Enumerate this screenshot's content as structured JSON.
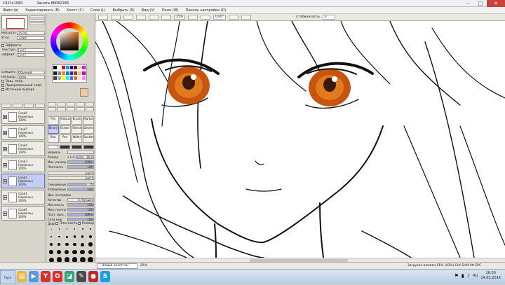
{
  "window": {
    "title": "1922x1080",
    "subtitle": "Занята 88082188",
    "controls": {
      "minimize": "–",
      "maximize": "□",
      "close": "✕"
    }
  },
  "menu": [
    "Файл (в)",
    "Редактировать (Е)",
    "Холст (С)",
    "Слой (L)",
    "Выбрать (S)",
    "Вид (V)",
    "Окно (W)",
    "Панель настройки (О)"
  ],
  "toolbar": {
    "angle": "0,00°",
    "zoom": "25%",
    "stabilizer_label": "Стабилизатор",
    "stabilizer_value": "3"
  },
  "navigator": {
    "zoom_label": "Масштаб",
    "zoom_value": "25.0%",
    "angle_label": "Угол",
    "angle_value": "+000°"
  },
  "layer_props": {
    "section": "Эффекты",
    "texture_label": "Текстура",
    "texture_value": "[нет]",
    "effect_label": "Эффект",
    "effect_value": "[нет]",
    "mode_label": "Смешение",
    "mode_value": "Обычный",
    "opacity_label": "Непрозрачн.",
    "opacity_value": "100%",
    "checks": [
      "Защ. непр.",
      "Прикрепленный слой",
      "Источник выбора"
    ]
  },
  "layers": [
    {
      "name": "Слой6",
      "mode": "Нормальн.",
      "opacity": "100%",
      "selected": false
    },
    {
      "name": "Слой5",
      "mode": "Нормальн.",
      "opacity": "100%",
      "selected": false
    },
    {
      "name": "Слой4",
      "mode": "Нормальн.",
      "opacity": "100%",
      "selected": false
    },
    {
      "name": "Слой3",
      "mode": "Нормальн.",
      "opacity": "100%",
      "selected": false
    },
    {
      "name": "Слой2",
      "mode": "Нормальн.",
      "opacity": "100%",
      "selected": true
    },
    {
      "name": "Слой1",
      "mode": "Нормальн.",
      "opacity": "100%",
      "selected": false
    },
    {
      "name": "Слой0",
      "mode": "Нормальн.",
      "opacity": "100%",
      "selected": false
    }
  ],
  "colors": {
    "current": "#f3c79a",
    "accent": "#c7cdf2",
    "swatches": [
      "#000000",
      "#ffffff",
      "#ff0000",
      "#00a0ff",
      "#0000ff",
      "#800000",
      "#ffcc99",
      "#ff00ff",
      "#222222",
      "#888888",
      "#ff8000",
      "#0080ff",
      "#3030a0",
      "#a04000",
      "#f0c080",
      "#c000c0",
      "#444444",
      "#aaaaaa",
      "#ffff00",
      "#00ffff",
      "#6060ff",
      "#c08040",
      "#ffe0c0",
      "#ff80ff"
    ]
  },
  "brushes": [
    "Pen",
    "Airbrush",
    "Brush",
    "Marker",
    "Binary",
    "Eraser",
    "Select",
    "Deselect",
    "Blur",
    "Pen",
    "Water",
    "Bucket"
  ],
  "brush_props": {
    "mode_label": "Нормаль",
    "size_label": "Размер",
    "size_mult": "x 1.0",
    "size_value": "10.0",
    "min_size_label": "Мин. размер",
    "min_size_value": "100%",
    "density_label": "Плотность",
    "density_value": "100",
    "shape_label": "[нет]",
    "texture_label": "[нет]",
    "blend_label": "Смешивание цвета",
    "blend_value": "75",
    "dilution_label": "Разбавление цвета",
    "dilution_value": "100",
    "advanced": "Доп. настройки",
    "quality_label": "Качество",
    "quality_value": "4 (Лучше)",
    "edge_label": "Жесткость",
    "edge_value": "100",
    "min_dens_label": "Мин. плотность",
    "min_dens_value": "100",
    "max_dens_label": "Плот. макс. давл.",
    "max_dens_value": "100%",
    "press_hard_label": "Сила наж.",
    "press_hard_value": "100",
    "pressure_label": "Давление",
    "pressure_opts": [
      "Плотность",
      "Размер"
    ]
  },
  "size_presets": [
    "0.7",
    "0.8",
    "1",
    "1.5",
    "2",
    "2.3",
    "3",
    "3.5",
    "4",
    "5",
    "6",
    "7",
    "8",
    "9",
    "10",
    "12",
    "14",
    "16",
    "20",
    "25",
    "30",
    "35",
    "40",
    "50",
    "60",
    "70",
    "80",
    "100",
    "120",
    "150",
    "200",
    "250",
    "300",
    "350",
    "400",
    "500"
  ],
  "status": {
    "file": "Новый холст.sai",
    "zoom": "25%",
    "memory": "Загрузка памяти 41% (43%) Ctrl Shift Alt SPC"
  },
  "taskbar": {
    "start": "Пуск",
    "lang": "RU",
    "time": "16:00",
    "date": "14.02.2016",
    "apps": [
      {
        "name": "explorer",
        "glyph": "▤",
        "color": "#e8b84a"
      },
      {
        "name": "media",
        "glyph": "▶",
        "color": "#5a9ad8"
      },
      {
        "name": "yandex",
        "glyph": "Y",
        "color": "#d9322b"
      },
      {
        "name": "opera",
        "glyph": "O",
        "color": "#d9322b"
      },
      {
        "name": "photos",
        "glyph": "◪",
        "color": "#3aa070"
      },
      {
        "name": "sai",
        "glyph": "✎",
        "color": "#4a4a4a"
      },
      {
        "name": "record",
        "glyph": "●",
        "color": "#c02a2a"
      },
      {
        "name": "skype",
        "glyph": "S",
        "color": "#1a9ee8"
      }
    ]
  }
}
